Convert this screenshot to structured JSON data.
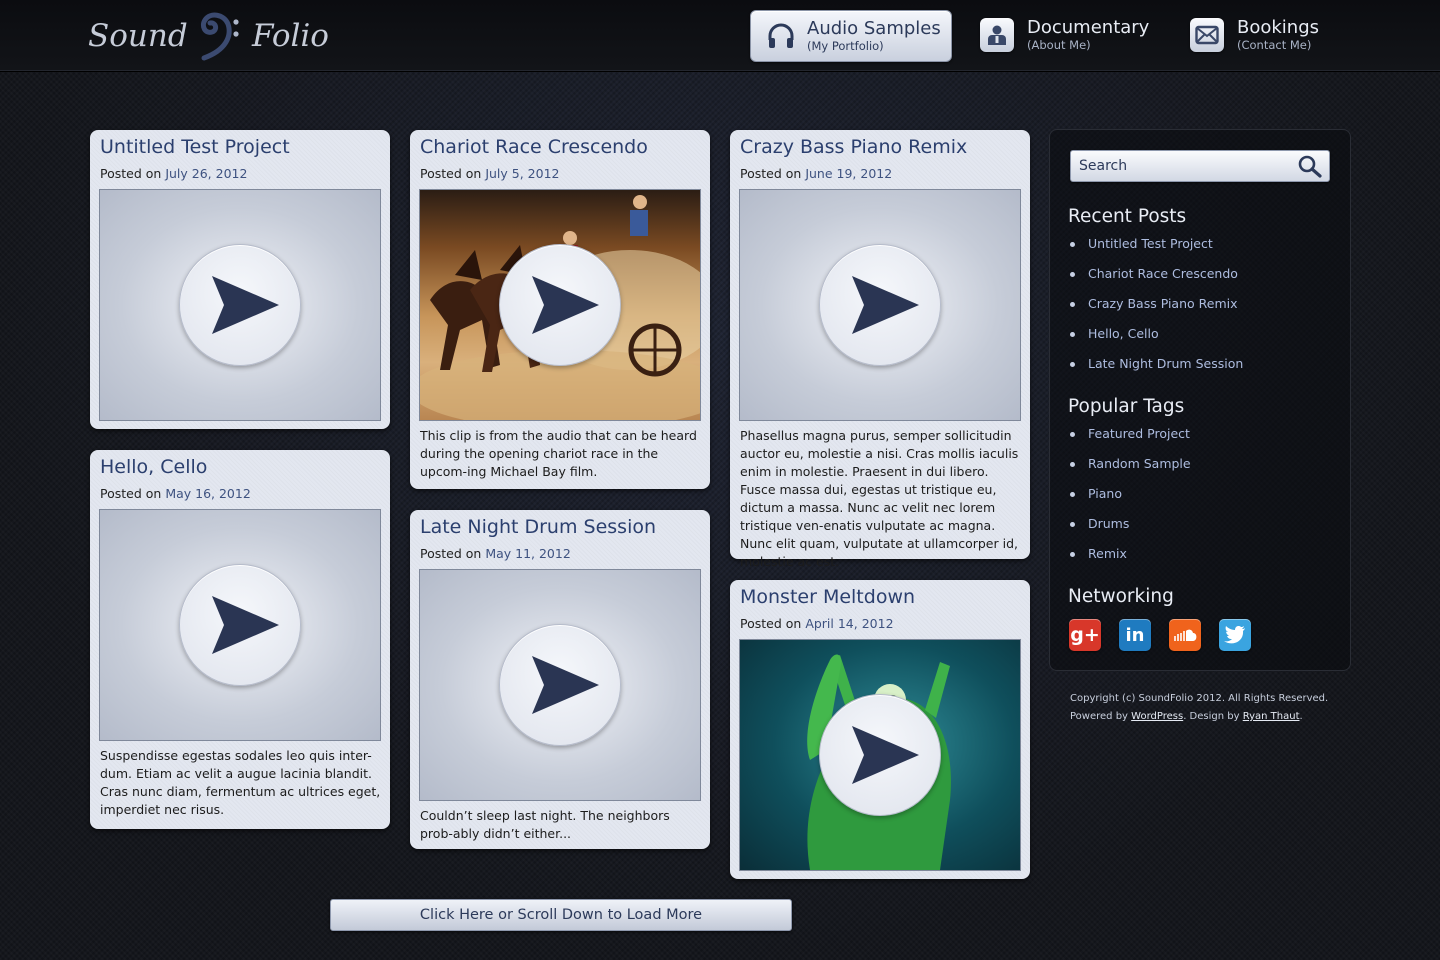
{
  "logo": {
    "word1": "Sound",
    "word2": "Folio"
  },
  "nav": [
    {
      "title": "Audio Samples",
      "subtitle": "(My Portfolio)",
      "icon": "headphones-icon"
    },
    {
      "title": "Documentary",
      "subtitle": "(About Me)",
      "icon": "person-icon"
    },
    {
      "title": "Bookings",
      "subtitle": "(Contact Me)",
      "icon": "envelope-icon"
    }
  ],
  "posts": [
    {
      "title": "Untitled Test Project",
      "posted_label": "Posted on",
      "date": "July 26, 2012",
      "media": "placeholder",
      "excerpt": ""
    },
    {
      "title": "Chariot Race Crescendo",
      "posted_label": "Posted on",
      "date": "July 5, 2012",
      "media": "chariot-race-image",
      "excerpt": "This clip is from the audio that can be heard during the opening chariot race in the upcom-ing Michael Bay film."
    },
    {
      "title": "Crazy Bass Piano Remix",
      "posted_label": "Posted on",
      "date": "June 19, 2012",
      "media": "placeholder",
      "excerpt": "Phasellus magna purus, semper sollicitudin auctor eu, molestie a nisi. Cras mollis iaculis enim in molestie. Praesent in dui libero. Fusce massa dui, egestas ut tristique eu, dictum a massa. Nunc ac velit nec lorem tristique ven-enatis vulputate ac magna. Nunc elit quam, vulputate at ullamcorper id, molestie ac est."
    },
    {
      "title": "Hello, Cello",
      "posted_label": "Posted on",
      "date": "May 16, 2012",
      "media": "placeholder",
      "excerpt": "Suspendisse egestas sodales leo quis inter-dum. Etiam ac velit a augue lacinia blandit. Cras nunc diam, fermentum ac ultrices eget, imperdiet nec risus."
    },
    {
      "title": "Late Night Drum Session",
      "posted_label": "Posted on",
      "date": "May 11, 2012",
      "media": "placeholder",
      "excerpt": "Couldn’t sleep last night. The neighbors prob-ably didn’t either..."
    },
    {
      "title": "Monster Meltdown",
      "posted_label": "Posted on",
      "date": "April 14, 2012",
      "media": "green-monster-image",
      "excerpt": ""
    }
  ],
  "sidebar": {
    "search_placeholder": "Search",
    "recent_title": "Recent Posts",
    "recent": [
      "Untitled Test Project",
      "Chariot Race Crescendo",
      "Crazy Bass Piano Remix",
      "Hello, Cello",
      "Late Night Drum Session"
    ],
    "tags_title": "Popular Tags",
    "tags": [
      "Featured Project",
      "Random Sample",
      "Piano",
      "Drums",
      "Remix"
    ],
    "networking_title": "Networking",
    "social": [
      {
        "label": "g+",
        "icon": "google-plus-icon",
        "color": "#d8372a"
      },
      {
        "label": "in",
        "icon": "linkedin-icon",
        "color": "#1f7bc0"
      },
      {
        "label": "",
        "icon": "soundcloud-icon",
        "color": "#f0631c"
      },
      {
        "label": "",
        "icon": "twitter-icon",
        "color": "#3aa4e0"
      }
    ]
  },
  "footer": {
    "copyright": "Copyright (c) SoundFolio 2012. All Rights Reserved.",
    "powered_by": "Powered by",
    "wordpress": "WordPress",
    "design_by": ". Design by",
    "designer": "Ryan Thaut",
    "end": "."
  },
  "load_more": "Click Here or Scroll Down to Load More",
  "colors": {
    "accent": "#2b3f6e",
    "card_bg": "#e3e7f0",
    "page_bg": "#15171d"
  }
}
